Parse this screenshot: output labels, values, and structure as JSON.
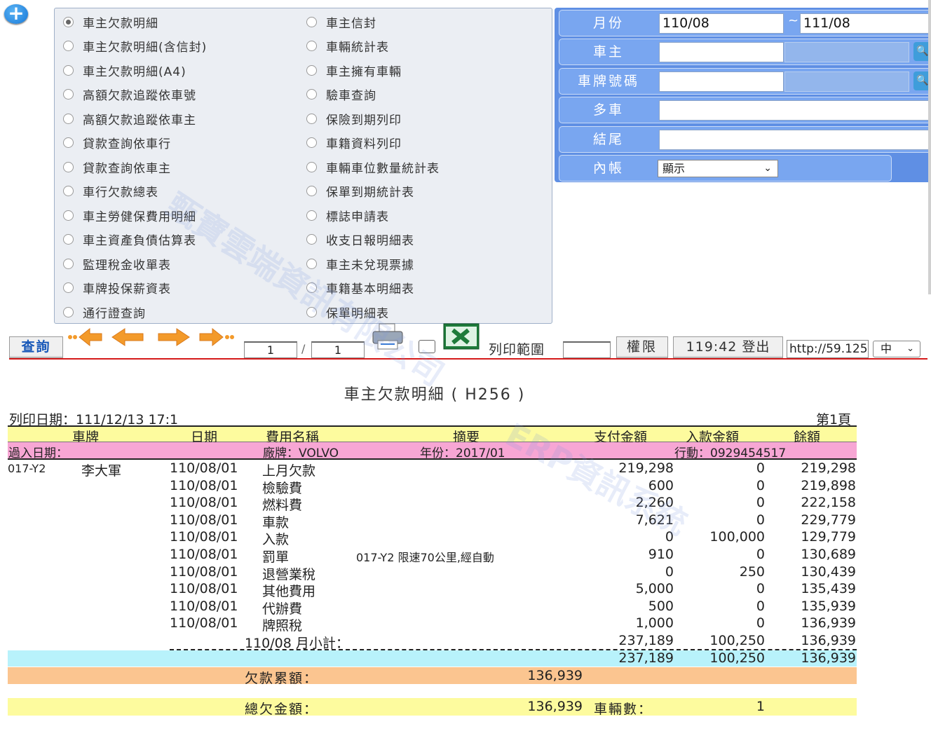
{
  "reports": {
    "left": [
      "車主欠款明細",
      "車主欠款明細(含信封)",
      "車主欠款明細(A4)",
      "高額欠款追蹤依車號",
      "高額欠款追蹤依車主",
      "貸款查詢依車行",
      "貸款查詢依車主",
      "車行欠款總表",
      "車主勞健保費用明細",
      "車主資產負債估算表",
      "監理稅金收單表",
      "車牌投保薪資表",
      "通行證查詢"
    ],
    "right": [
      "車主信封",
      "車輛統計表",
      "車主擁有車輛",
      "驗車查詢",
      "保險到期列印",
      "車籍資料列印",
      "車輛車位數量統計表",
      "保單到期統計表",
      "標誌申請表",
      "收支日報明細表",
      "車主未兌現票據",
      "車籍基本明細表",
      "保單明細表"
    ],
    "selected": "車主欠款明細"
  },
  "filters": {
    "month_label": "月份",
    "month_from": "110/08",
    "tilde": "~",
    "month_to": "111/08",
    "owner_label": "車主",
    "plate_label": "車牌號碼",
    "multi_label": "多車",
    "ending_label": "結尾",
    "internal_label": "內帳",
    "internal_value": "顯示"
  },
  "toolbar": {
    "query_label": "查詢",
    "page_current": "1",
    "page_slash": "/",
    "page_total": "1",
    "range_label": "列印範圍",
    "permission_label": "權限",
    "logout_label": "119:42 登出",
    "url_value": "http://59.125",
    "lang_value": "中"
  },
  "report": {
    "title": "車主欠款明細 ( H256 )",
    "print_date": "列印日期：111/12/13 17:1",
    "page_label": "第1頁",
    "headers": [
      "車牌",
      "日期",
      "費用名稱",
      "摘要",
      "支付金額",
      "入款金額",
      "餘額"
    ],
    "info": {
      "entry_date": "過入日期：",
      "brand": "廠牌：VOLVO",
      "year": "年份：2017/01",
      "mobile": "行動：0929454517"
    },
    "plate": "017-Y2",
    "owner": "李大軍",
    "rows": [
      {
        "date": "110/08/01",
        "item": "上月欠款",
        "memo": "",
        "pay": "219,298",
        "receive": "0",
        "balance": "219,298"
      },
      {
        "date": "110/08/01",
        "item": "檢驗費",
        "memo": "",
        "pay": "600",
        "receive": "0",
        "balance": "219,898"
      },
      {
        "date": "110/08/01",
        "item": "燃料費",
        "memo": "",
        "pay": "2,260",
        "receive": "0",
        "balance": "222,158"
      },
      {
        "date": "110/08/01",
        "item": "車款",
        "memo": "",
        "pay": "7,621",
        "receive": "0",
        "balance": "229,779"
      },
      {
        "date": "110/08/01",
        "item": "入款",
        "memo": "",
        "pay": "0",
        "receive": "100,000",
        "balance": "129,779"
      },
      {
        "date": "110/08/01",
        "item": "罰單",
        "memo": "017-Y2 限速70公里,經自動",
        "pay": "910",
        "receive": "0",
        "balance": "130,689"
      },
      {
        "date": "110/08/01",
        "item": "退營業稅",
        "memo": "",
        "pay": "0",
        "receive": "250",
        "balance": "130,439"
      },
      {
        "date": "110/08/01",
        "item": "其他費用",
        "memo": "",
        "pay": "5,000",
        "receive": "0",
        "balance": "135,439"
      },
      {
        "date": "110/08/01",
        "item": "代辦費",
        "memo": "",
        "pay": "500",
        "receive": "0",
        "balance": "135,939"
      },
      {
        "date": "110/08/01",
        "item": "牌照稅",
        "memo": "",
        "pay": "1,000",
        "receive": "0",
        "balance": "136,939"
      }
    ],
    "subtotal": {
      "label": "110/08 月小計：",
      "pay": "237,189",
      "receive": "100,250",
      "balance": "136,939"
    },
    "total": {
      "pay": "237,189",
      "receive": "100,250",
      "balance": "136,939"
    },
    "accum_label": "欠款累額：",
    "accum_value": "136,939",
    "grand_label": "總欠金額：",
    "grand_value": "136,939",
    "vehicles_label": "車輛數：",
    "vehicles_value": "1"
  },
  "watermarks": [
    "甄寶雲端資訊有限公司",
    "ERP資訊系統"
  ]
}
